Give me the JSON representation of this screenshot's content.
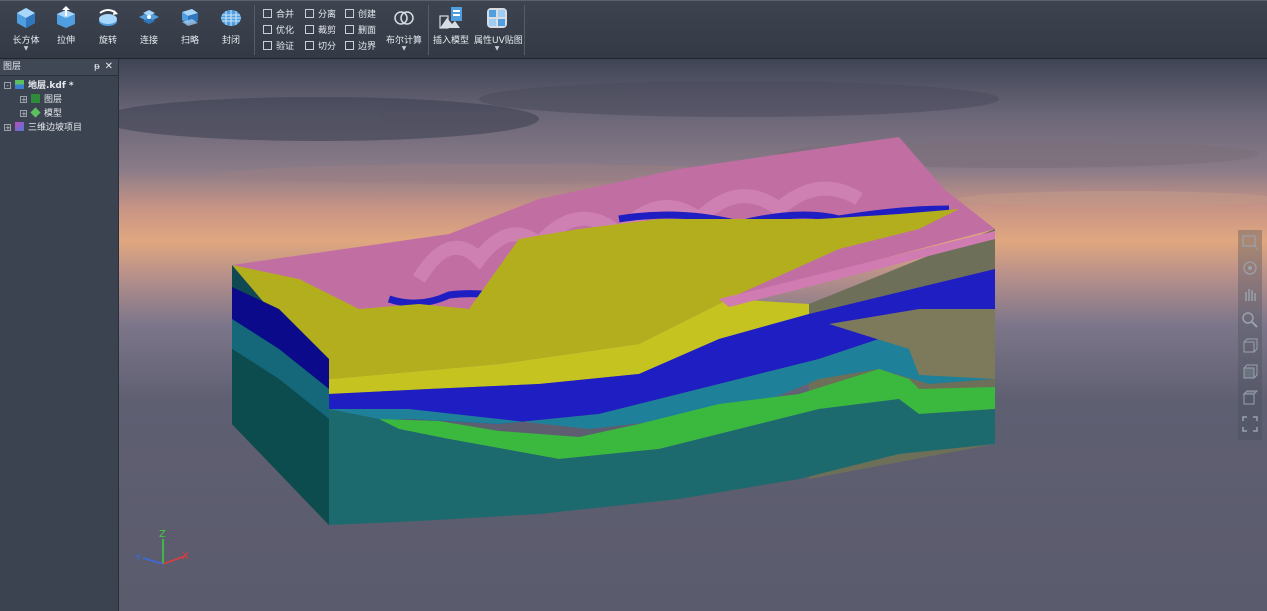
{
  "toolbar": {
    "big_buttons": [
      {
        "label": "长方体",
        "icon": "cuboid-icon",
        "has_dropdown": true
      },
      {
        "label": "拉伸",
        "icon": "extrude-icon"
      },
      {
        "label": "旋转",
        "icon": "rotate-icon"
      },
      {
        "label": "连接",
        "icon": "connect-icon"
      },
      {
        "label": "扫略",
        "icon": "sweep-icon"
      },
      {
        "label": "封闭",
        "icon": "close-mesh-icon"
      }
    ],
    "small_buttons": [
      {
        "label": "合并",
        "icon": "merge-icon"
      },
      {
        "label": "优化",
        "icon": "optimize-icon"
      },
      {
        "label": "验证",
        "icon": "verify-icon"
      },
      {
        "label": "分离",
        "icon": "separate-icon"
      },
      {
        "label": "裁剪",
        "icon": "clip-icon"
      },
      {
        "label": "切分",
        "icon": "split-icon"
      },
      {
        "label": "创建",
        "icon": "create-icon"
      },
      {
        "label": "删面",
        "icon": "delete-face-icon"
      },
      {
        "label": "边界",
        "icon": "boundary-icon"
      }
    ],
    "boolean_label": "布尔计算",
    "insert_model_label": "插入模型",
    "uv_label": "属性UV贴图"
  },
  "layer_panel": {
    "title": "图层",
    "pin": "ᵽ",
    "close": "✕",
    "tree": [
      {
        "label": "地层.kdf *",
        "expander": "-",
        "icon": "layer-file-icon"
      },
      {
        "label": "图层",
        "expander": "+",
        "icon": "layer-group-icon"
      },
      {
        "label": "模型",
        "expander": "+",
        "icon": "model-icon"
      },
      {
        "label": "三维边坡项目",
        "expander": "+",
        "icon": "project-icon"
      }
    ]
  },
  "axes": {
    "x": "X",
    "y": "Y",
    "z": "Z"
  },
  "right_tools": [
    "box-select-icon",
    "orbit-icon",
    "pan-hand-icon",
    "zoom-icon",
    "front-view-icon",
    "side-view-icon",
    "top-view-icon",
    "fit-view-icon"
  ],
  "colors": {
    "toolbar_bg": "#383f4a",
    "panel_bg": "#3c4350",
    "strata_pink": "#c16fa2",
    "strata_yellow": "#b2ae1e",
    "strata_blue": "#1f1ec2",
    "strata_teal": "#1e8099",
    "strata_green": "#3bb83e",
    "strata_dark_teal": "#1d6a6e"
  }
}
